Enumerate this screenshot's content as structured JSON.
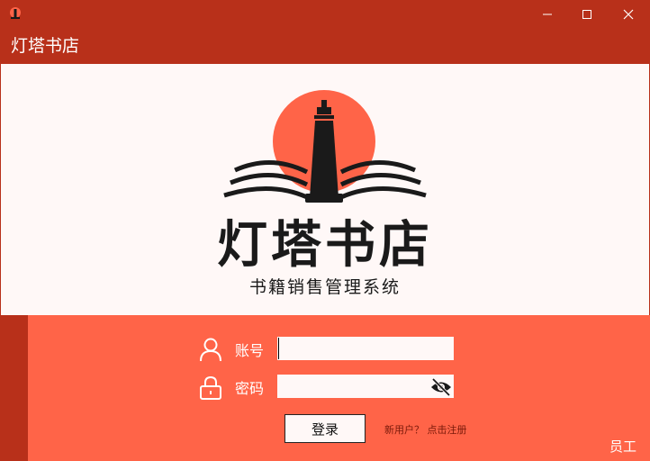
{
  "window": {
    "icon": "lighthouse-icon",
    "controls": [
      "minimize-icon",
      "maximize-icon",
      "close-icon"
    ]
  },
  "header": {
    "title": "灯塔书店"
  },
  "logo": {
    "name": "灯塔书店",
    "subtitle": "书籍销售管理系统",
    "sun_color": "#ff6448",
    "ink_color": "#1a1a1a"
  },
  "login": {
    "account_label": "账号",
    "account_value": "",
    "password_label": "密码",
    "password_value": "",
    "submit_label": "登录",
    "register_text": "新用户？ 点击注册",
    "role_label": "员工"
  },
  "colors": {
    "primary_dark": "#b8301a",
    "primary": "#ff6448",
    "surface": "#fff8f7"
  }
}
